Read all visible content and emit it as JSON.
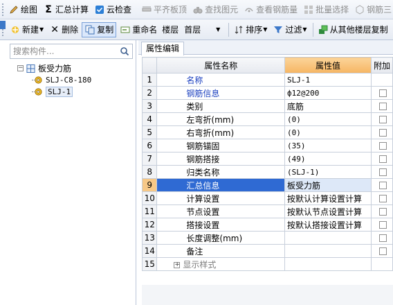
{
  "toolbar1": {
    "draw": "绘图",
    "sum_calc": "汇总计算",
    "cloud_check": "云检查",
    "align_slab_top": "平齐板顶",
    "find_element": "查找图元",
    "view_rebar": "查看钢筋量",
    "batch_select": "批量选择",
    "rebar_3d": "钢筋三"
  },
  "toolbar2": {
    "new": "新建",
    "delete": "删除",
    "copy": "复制",
    "rename": "重命名",
    "floor_label": "楼层",
    "floor_value": "首层",
    "sort": "排序",
    "filter": "过滤",
    "copy_from_floor": "从其他楼层复制"
  },
  "left_panel": {
    "search_placeholder": "搜索构件...",
    "tree_root": "板受力筋",
    "tree_items": [
      "SLJ-C8-180",
      "SLJ-1"
    ]
  },
  "property_panel": {
    "tab": "属性编辑",
    "columns": [
      "属性名称",
      "属性值",
      "附加"
    ],
    "rows": [
      {
        "idx": "1",
        "name": "名称",
        "value": "SLJ-1"
      },
      {
        "idx": "2",
        "name": "钢筋信息",
        "value": "ф12@200"
      },
      {
        "idx": "3",
        "name": "类别",
        "value": "底筋"
      },
      {
        "idx": "4",
        "name": "左弯折(mm)",
        "value": "(0)"
      },
      {
        "idx": "5",
        "name": "右弯折(mm)",
        "value": "(0)"
      },
      {
        "idx": "6",
        "name": "钢筋锚固",
        "value": "(35)"
      },
      {
        "idx": "7",
        "name": "钢筋搭接",
        "value": "(49)"
      },
      {
        "idx": "8",
        "name": "归类名称",
        "value": "(SLJ-1)"
      },
      {
        "idx": "9",
        "name": "汇总信息",
        "value": "板受力筋"
      },
      {
        "idx": "10",
        "name": "计算设置",
        "value": "按默认计算设置计算"
      },
      {
        "idx": "11",
        "name": "节点设置",
        "value": "按默认节点设置计算"
      },
      {
        "idx": "12",
        "name": "搭接设置",
        "value": "按默认搭接设置计算"
      },
      {
        "idx": "13",
        "name": "长度调整(mm)",
        "value": ""
      },
      {
        "idx": "14",
        "name": "备注",
        "value": ""
      },
      {
        "idx": "15",
        "name": "显示样式",
        "value": ""
      }
    ]
  },
  "colors": {
    "selected_row": "#2f6ad3",
    "value_header": "#f6b563",
    "link_text": "#1a3fbf"
  }
}
